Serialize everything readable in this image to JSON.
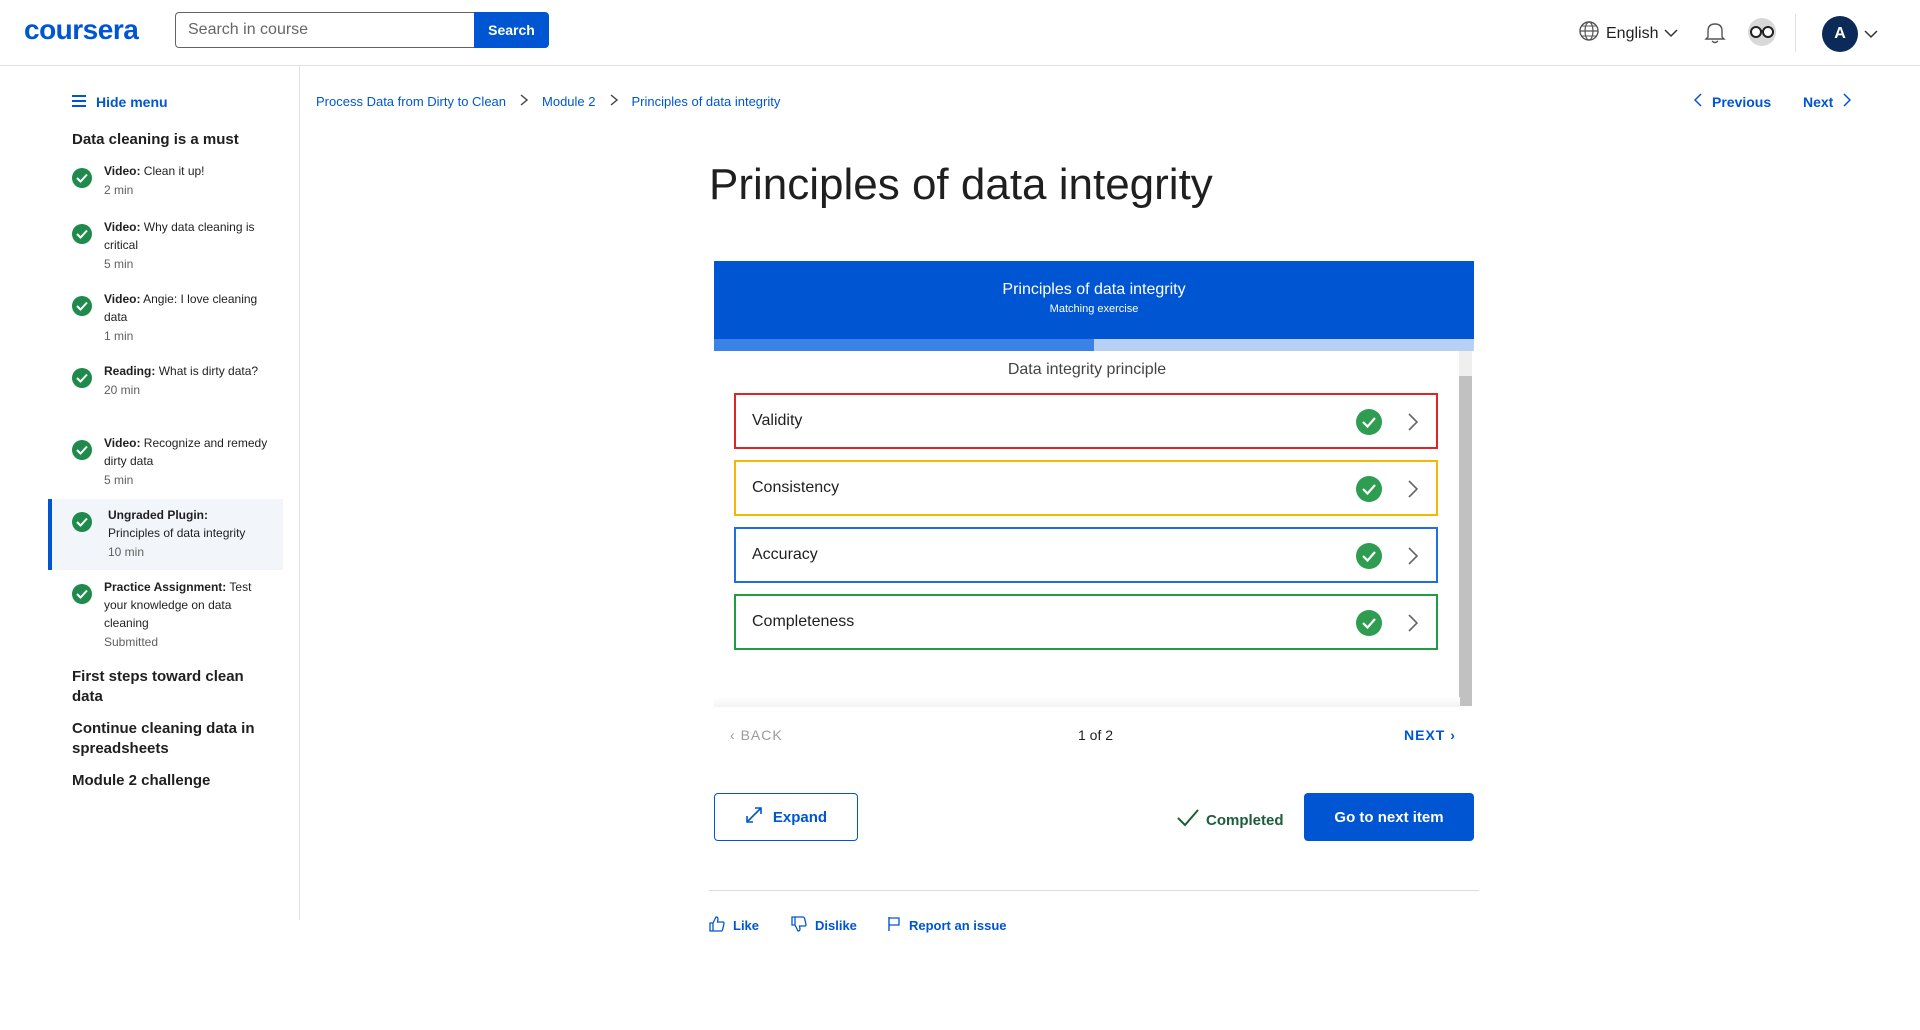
{
  "header": {
    "logo": "coursera",
    "search_placeholder": "Search in course",
    "search_button": "Search",
    "language": "English",
    "avatar_initial": "A"
  },
  "sidebar": {
    "hide_menu": "Hide menu",
    "module_title": "Data cleaning is a must",
    "items": [
      {
        "type": "Video:",
        "title": "Clean it up!",
        "meta": "2 min"
      },
      {
        "type": "Video:",
        "title": "Why data cleaning is critical",
        "meta": "5 min"
      },
      {
        "type": "Video:",
        "title": "Angie: I love cleaning data",
        "meta": "1 min"
      },
      {
        "type": "Reading:",
        "title": "What is dirty data?",
        "meta": "20 min"
      },
      {
        "type": "Video:",
        "title": "Recognize and remedy dirty data",
        "meta": "5 min"
      },
      {
        "type": "Ungraded Plugin:",
        "title": "Principles of data integrity",
        "meta": "10 min"
      },
      {
        "type": "Practice Assignment:",
        "title": "Test your knowledge on data cleaning",
        "meta": "Submitted"
      }
    ],
    "other_sections": [
      "First steps toward clean data",
      "Continue cleaning data in spreadsheets",
      "Module 2 challenge"
    ]
  },
  "breadcrumb": [
    "Process Data from Dirty to Clean",
    "Module 2",
    "Principles of data integrity"
  ],
  "nav": {
    "previous": "Previous",
    "next": "Next"
  },
  "page_title": "Principles of data integrity",
  "plugin": {
    "title": "Principles of data integrity",
    "subtitle": "Matching exercise",
    "progress": 0.5,
    "column_header": "Data integrity principle",
    "rows": [
      {
        "label": "Validity",
        "color": "#e02424"
      },
      {
        "label": "Consistency",
        "color": "#f5b800"
      },
      {
        "label": "Accuracy",
        "color": "#1f6fe0"
      },
      {
        "label": "Completeness",
        "color": "#1f9d45"
      }
    ],
    "back": "BACK",
    "counter": "1 of 2",
    "next": "NEXT"
  },
  "actions": {
    "expand": "Expand",
    "completed": "Completed",
    "go_next": "Go to next item"
  },
  "feedback": {
    "like": "Like",
    "dislike": "Dislike",
    "report": "Report an issue"
  }
}
